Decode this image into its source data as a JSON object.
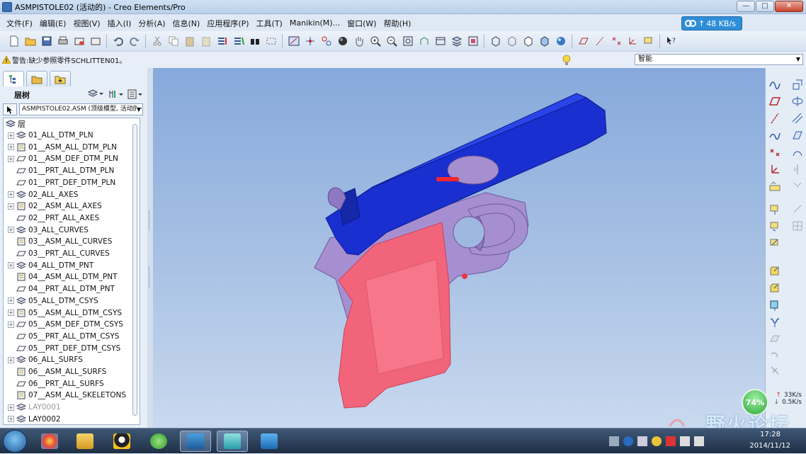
{
  "window": {
    "title": "ASMPISTOLE02 (活动的) - Creo Elements/Pro",
    "buttons": {
      "minimize": "—",
      "maximize": "□",
      "close": "✕"
    }
  },
  "menubar": {
    "items": [
      {
        "label": "文件(F)"
      },
      {
        "label": "编辑(E)"
      },
      {
        "label": "视图(V)"
      },
      {
        "label": "插入(I)"
      },
      {
        "label": "分析(A)"
      },
      {
        "label": "信息(N)"
      },
      {
        "label": "应用程序(P)"
      },
      {
        "label": "工具(T)"
      },
      {
        "label": "Manikin(M)..."
      },
      {
        "label": "窗口(W)"
      },
      {
        "label": "帮助(H)"
      }
    ],
    "net_widget": {
      "rate": "48 KB/s"
    }
  },
  "status": {
    "warning": "警告:缺少参照零件SCHLITTEN01。",
    "filter_value": "智能"
  },
  "left_panel": {
    "header_label": "层树",
    "model_selector": "ASMPISTOLE02.ASM (顶级模型, 活动的)",
    "root_label": "层",
    "layers": [
      {
        "label": "01_ALL_DTM_PLN",
        "icon": "layer-stack",
        "expandable": true
      },
      {
        "label": "01__ASM_ALL_DTM_PLN",
        "icon": "rule-layer",
        "expandable": true
      },
      {
        "label": "01__ASM_DEF_DTM_PLN",
        "icon": "datum-plane",
        "expandable": true
      },
      {
        "label": "01__PRT_ALL_DTM_PLN",
        "icon": "datum-plane",
        "expandable": false
      },
      {
        "label": "01__PRT_DEF_DTM_PLN",
        "icon": "datum-plane",
        "expandable": false
      },
      {
        "label": "02_ALL_AXES",
        "icon": "layer-stack",
        "expandable": true
      },
      {
        "label": "02__ASM_ALL_AXES",
        "icon": "rule-layer",
        "expandable": true
      },
      {
        "label": "02__PRT_ALL_AXES",
        "icon": "datum-plane",
        "expandable": false
      },
      {
        "label": "03_ALL_CURVES",
        "icon": "layer-stack",
        "expandable": true
      },
      {
        "label": "03__ASM_ALL_CURVES",
        "icon": "rule-layer",
        "expandable": false
      },
      {
        "label": "03__PRT_ALL_CURVES",
        "icon": "datum-plane",
        "expandable": false
      },
      {
        "label": "04_ALL_DTM_PNT",
        "icon": "layer-stack",
        "expandable": true
      },
      {
        "label": "04__ASM_ALL_DTM_PNT",
        "icon": "rule-layer",
        "expandable": false
      },
      {
        "label": "04__PRT_ALL_DTM_PNT",
        "icon": "datum-plane",
        "expandable": false
      },
      {
        "label": "05_ALL_DTM_CSYS",
        "icon": "layer-stack",
        "expandable": true
      },
      {
        "label": "05__ASM_ALL_DTM_CSYS",
        "icon": "rule-layer",
        "expandable": true
      },
      {
        "label": "05__ASM_DEF_DTM_CSYS",
        "icon": "datum-plane",
        "expandable": true
      },
      {
        "label": "05__PRT_ALL_DTM_CSYS",
        "icon": "datum-plane",
        "expandable": false
      },
      {
        "label": "05__PRT_DEF_DTM_CSYS",
        "icon": "datum-plane",
        "expandable": false
      },
      {
        "label": "06_ALL_SURFS",
        "icon": "layer-stack",
        "expandable": true
      },
      {
        "label": "06__ASM_ALL_SURFS",
        "icon": "rule-layer",
        "expandable": false
      },
      {
        "label": "06__PRT_ALL_SURFS",
        "icon": "datum-plane",
        "expandable": false
      },
      {
        "label": "07__ASM_ALL_SKELETONS",
        "icon": "rule-layer",
        "expandable": false
      },
      {
        "label": "LAY0001",
        "icon": "layer-stack",
        "expandable": true,
        "dimmed": true
      },
      {
        "label": "LAY0002",
        "icon": "layer-stack",
        "expandable": true
      }
    ]
  },
  "viewport": {
    "colors": {
      "slide": "#1a2fd0",
      "frame": "#a58fd0",
      "grip": "#f2647a",
      "background_top": "#86a9dc",
      "background_bottom": "#c9d9ef"
    }
  },
  "system_widgets": {
    "cpu_percent": "74%",
    "upload_rate": "33K/s",
    "download_rate": "0.5K/s",
    "watermark": "野火论坛",
    "clock_time": "17:28",
    "clock_date": "2014/11/12"
  }
}
